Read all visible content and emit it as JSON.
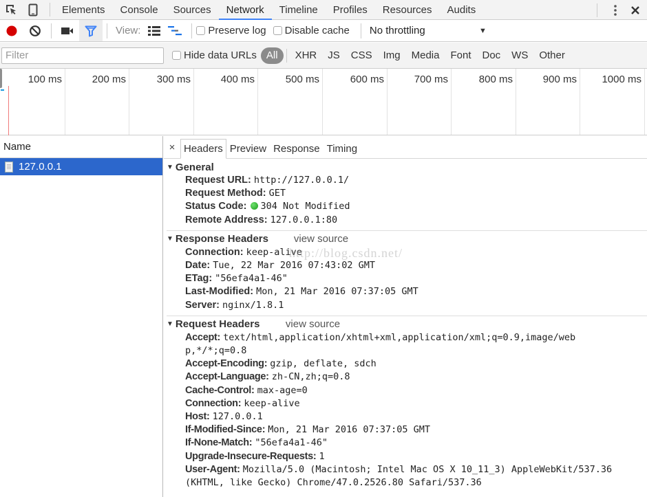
{
  "devtools": {
    "main_tabs": [
      {
        "label": "Elements",
        "active": false
      },
      {
        "label": "Console",
        "active": false
      },
      {
        "label": "Sources",
        "active": false
      },
      {
        "label": "Network",
        "active": true
      },
      {
        "label": "Timeline",
        "active": false
      },
      {
        "label": "Profiles",
        "active": false
      },
      {
        "label": "Resources",
        "active": false
      },
      {
        "label": "Audits",
        "active": false
      }
    ],
    "icons": {
      "inspect": "inspect-element-icon",
      "device": "device-mode-icon",
      "more": "more-options-icon",
      "close": "close-icon"
    }
  },
  "toolbar": {
    "record_color": "#d50000",
    "filter_color": "#3e82f7",
    "view_label": "View:",
    "preserve_log_label": "Preserve log",
    "preserve_log_checked": false,
    "disable_cache_label": "Disable cache",
    "disable_cache_checked": false,
    "throttling_value": "No throttling"
  },
  "filterbar": {
    "filter_placeholder": "Filter",
    "filter_value": "",
    "hide_data_urls_label": "Hide data URLs",
    "hide_data_urls_checked": false,
    "types": [
      {
        "label": "All",
        "active": true
      },
      {
        "label": "XHR",
        "active": false
      },
      {
        "label": "JS",
        "active": false
      },
      {
        "label": "CSS",
        "active": false
      },
      {
        "label": "Img",
        "active": false
      },
      {
        "label": "Media",
        "active": false
      },
      {
        "label": "Font",
        "active": false
      },
      {
        "label": "Doc",
        "active": false
      },
      {
        "label": "WS",
        "active": false
      },
      {
        "label": "Other",
        "active": false
      }
    ]
  },
  "overview": {
    "ticks": [
      "100 ms",
      "200 ms",
      "300 ms",
      "400 ms",
      "500 ms",
      "600 ms",
      "700 ms",
      "800 ms",
      "900 ms",
      "1000 ms"
    ]
  },
  "request_list": {
    "column_header": "Name",
    "rows": [
      {
        "name": "127.0.0.1",
        "selected": true
      }
    ]
  },
  "detail": {
    "close_glyph": "×",
    "tabs": [
      {
        "label": "Headers",
        "active": true
      },
      {
        "label": "Preview",
        "active": false
      },
      {
        "label": "Response",
        "active": false
      },
      {
        "label": "Timing",
        "active": false
      }
    ],
    "general": {
      "title": "General",
      "rows": [
        {
          "key": "Request URL:",
          "value": "http://127.0.0.1/"
        },
        {
          "key": "Request Method:",
          "value": "GET"
        },
        {
          "key": "Status Code:",
          "value": "304 Not Modified",
          "status_color": "#2db52d"
        },
        {
          "key": "Remote Address:",
          "value": "127.0.0.1:80"
        }
      ]
    },
    "response_headers": {
      "title": "Response Headers",
      "view_source": "view source",
      "rows": [
        {
          "key": "Connection:",
          "value": "keep-alive"
        },
        {
          "key": "Date:",
          "value": "Tue, 22 Mar 2016 07:43:02 GMT"
        },
        {
          "key": "ETag:",
          "value": "\"56efa4a1-46\""
        },
        {
          "key": "Last-Modified:",
          "value": "Mon, 21 Mar 2016 07:37:05 GMT"
        },
        {
          "key": "Server:",
          "value": "nginx/1.8.1"
        }
      ]
    },
    "request_headers": {
      "title": "Request Headers",
      "view_source": "view source",
      "rows": [
        {
          "key": "Accept:",
          "value": "text/html,application/xhtml+xml,application/xml;q=0.9,image/web",
          "cont": "p,*/*;q=0.8"
        },
        {
          "key": "Accept-Encoding:",
          "value": "gzip, deflate, sdch"
        },
        {
          "key": "Accept-Language:",
          "value": "zh-CN,zh;q=0.8"
        },
        {
          "key": "Cache-Control:",
          "value": "max-age=0"
        },
        {
          "key": "Connection:",
          "value": "keep-alive"
        },
        {
          "key": "Host:",
          "value": "127.0.0.1"
        },
        {
          "key": "If-Modified-Since:",
          "value": "Mon, 21 Mar 2016 07:37:05 GMT"
        },
        {
          "key": "If-None-Match:",
          "value": "\"56efa4a1-46\""
        },
        {
          "key": "Upgrade-Insecure-Requests:",
          "value": "1"
        },
        {
          "key": "User-Agent:",
          "value": "Mozilla/5.0 (Macintosh; Intel Mac OS X 10_11_3) AppleWebKit/537.36",
          "cont": "(KHTML, like Gecko) Chrome/47.0.2526.80 Safari/537.36"
        }
      ]
    }
  },
  "watermark": "http://blog.csdn.net/"
}
